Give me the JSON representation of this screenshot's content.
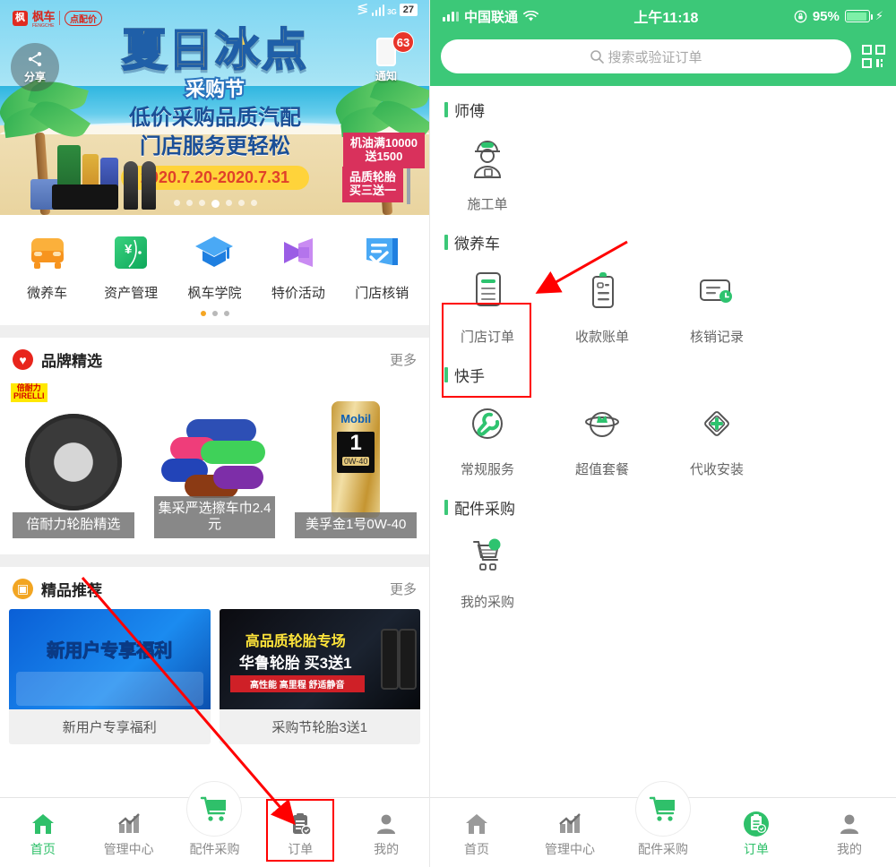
{
  "left_phone": {
    "banner": {
      "logo_text": "枫车",
      "logo_sub": "FENGCHE",
      "logo_pill": "点配价",
      "share_label": "分享",
      "notify_label": "通知",
      "notify_badge": "63",
      "hud_network": "3G",
      "hud_number": "27",
      "title_main": "夏日冰点",
      "title_sub": "采购节",
      "line1": "低价采购品质汽配",
      "line2": "门店服务更轻松",
      "date_range": "2020.7.20-2020.7.31",
      "flag1_line1": "机油满10000",
      "flag1_line2": "送1500",
      "flag2_line1": "品质轮胎",
      "flag2_line2": "买三送一",
      "dot_count": 7,
      "dot_active_index": 3
    },
    "quick_entries": [
      {
        "label": "微养车",
        "icon": "car-icon",
        "color": "#f7a62c"
      },
      {
        "label": "资产管理",
        "icon": "yen-card-icon",
        "color": "#24b26a"
      },
      {
        "label": "枫车学院",
        "icon": "graduation-cap-icon",
        "color": "#3a9bf0"
      },
      {
        "label": "特价活动",
        "icon": "megaphone-icon",
        "color": "#a96ae0"
      },
      {
        "label": "门店核销",
        "icon": "check-receipt-icon",
        "color": "#3a9bf0"
      }
    ],
    "pager": {
      "count": 3,
      "active_index": 0
    },
    "brand_section": {
      "icon": "heart-icon",
      "icon_color": "#e8251c",
      "title": "品牌精选",
      "more": "更多",
      "cards": [
        {
          "caption": "倍耐力轮胎精选",
          "brand_badge_top": "倍耐力",
          "brand_badge_bottom": "PIRELLI",
          "image": "tire-image"
        },
        {
          "caption": "集采严选擦车巾2.4元",
          "image": "towels-image"
        },
        {
          "caption": "美孚金1号0W-40",
          "image": "mobil-bottle-image",
          "bottle_brand": "Mobil",
          "bottle_number": "1",
          "bottle_grade": "0W-40"
        }
      ]
    },
    "recommend_section": {
      "icon": "book-icon",
      "icon_color": "#f2a522",
      "title": "精品推荐",
      "more": "更多",
      "cards": [
        {
          "caption": "新用户专享福利",
          "banner_text": "新用户专享福利"
        },
        {
          "caption": "采购节轮胎3送1",
          "banner_text1": "高品质轮胎专场",
          "banner_text2": "华鲁轮胎 买3送1",
          "banner_text3": "高性能 高里程 舒适静音"
        }
      ]
    },
    "tabbar": [
      {
        "label": "首页",
        "icon": "home-icon",
        "active": true
      },
      {
        "label": "管理中心",
        "icon": "chart-icon",
        "active": false
      },
      {
        "label": "配件采购",
        "icon": "cart-icon",
        "active": false,
        "center": true
      },
      {
        "label": "订单",
        "icon": "order-clipboard-icon",
        "active": false,
        "highlighted": true
      },
      {
        "label": "我的",
        "icon": "person-icon",
        "active": false
      }
    ]
  },
  "right_phone": {
    "status_bar": {
      "carrier": "中国联通",
      "time": "上午11:18",
      "battery_percent": "95%",
      "wifi_icon": "wifi-icon",
      "lock_rotation_icon": "rotation-lock-icon",
      "charging_icon": "bolt-icon"
    },
    "search": {
      "placeholder": "搜索或验证订单",
      "icon": "search-icon",
      "scan_icon": "qr-scan-icon"
    },
    "groups": [
      {
        "title": "师傅",
        "items": [
          {
            "label": "施工单",
            "icon": "worker-helmet-icon"
          }
        ]
      },
      {
        "title": "微养车",
        "items": [
          {
            "label": "门店订单",
            "icon": "document-icon",
            "highlighted": true
          },
          {
            "label": "收款账单",
            "icon": "clipboard-bill-icon"
          },
          {
            "label": "核销记录",
            "icon": "card-clock-icon"
          }
        ]
      },
      {
        "title": "快手",
        "items": [
          {
            "label": "常规服务",
            "icon": "wrench-circle-icon"
          },
          {
            "label": "超值套餐",
            "icon": "package-crown-icon"
          },
          {
            "label": "代收安装",
            "icon": "diamond-plus-icon"
          }
        ]
      },
      {
        "title": "配件采购",
        "items": [
          {
            "label": "我的采购",
            "icon": "shopping-cart-icon"
          }
        ]
      }
    ],
    "tabbar": [
      {
        "label": "首页",
        "icon": "home-icon",
        "active": false
      },
      {
        "label": "管理中心",
        "icon": "chart-icon",
        "active": false
      },
      {
        "label": "配件采购",
        "icon": "cart-icon",
        "active": false,
        "center": true
      },
      {
        "label": "订单",
        "icon": "order-clipboard-icon",
        "active": true
      },
      {
        "label": "我的",
        "icon": "person-icon",
        "active": false
      }
    ]
  },
  "annotations": {
    "accent_red": "#ff0000",
    "accent_green": "#3cc878",
    "arrow_count": 3
  }
}
